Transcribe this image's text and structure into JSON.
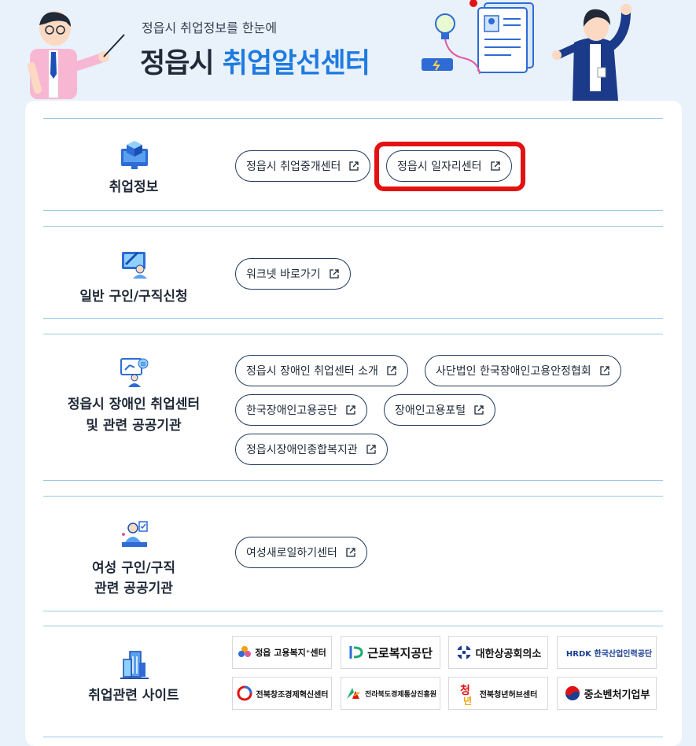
{
  "hero": {
    "subtitle": "정읍시 취업정보를 한눈에",
    "title_prefix": "정읍시 ",
    "title_accent": "취업알선센터"
  },
  "sections": [
    {
      "icon": "monitor-box-icon",
      "label": "취업정보",
      "links": [
        {
          "label": "정읍시 취업중개센터"
        },
        {
          "label": "정읍시 일자리센터",
          "highlighted": true
        }
      ]
    },
    {
      "icon": "pen-monitor-person-icon",
      "label": "일반 구인/구직신청",
      "links": [
        {
          "label": "워크넷 바로가기"
        }
      ]
    },
    {
      "icon": "presentation-person-icon",
      "label_line1": "정읍시 장애인 취업센터",
      "label_line2": "및 관련 공공기관",
      "links": [
        {
          "label": "정읍시 장애인 취업센터 소개"
        },
        {
          "label": "사단법인 한국장애인고용안정협회"
        },
        {
          "label": "한국장애인고용공단"
        },
        {
          "label": "장애인고용포털"
        },
        {
          "label": "정읍시장애인종합복지관"
        }
      ]
    },
    {
      "icon": "woman-desk-icon",
      "label_line1": "여성 구인/구직",
      "label_line2": "관련 공공기관",
      "links": [
        {
          "label": "여성새로일하기센터"
        }
      ]
    },
    {
      "icon": "buildings-icon",
      "label": "취업관련 사이트",
      "logos": [
        {
          "text": "정읍 고용복지⁺센터",
          "icon": "jobcenter-logo-icon"
        },
        {
          "text": "근로복지공단",
          "icon": "comwel-logo-icon"
        },
        {
          "text": "대한상공회의소",
          "icon": "korcham-logo-icon"
        },
        {
          "text": "HRDK 한국산업인력공단",
          "icon": "hrdk-logo-icon"
        },
        {
          "text": "전북창조경제혁신센터",
          "icon": "ccei-logo-icon"
        },
        {
          "text": "전라북도경제통상진흥원",
          "icon": "jbba-logo-icon"
        },
        {
          "text": "전북청년허브센터",
          "icon": "youthhub-logo-icon"
        },
        {
          "text": "중소벤처기업부",
          "icon": "mss-logo-icon"
        }
      ]
    }
  ],
  "colors": {
    "accent": "#1e7be0",
    "highlight_border": "#e31212",
    "pill_border": "#223a5e",
    "divider": "#9cc8e6",
    "background": "#e9f1fb"
  }
}
